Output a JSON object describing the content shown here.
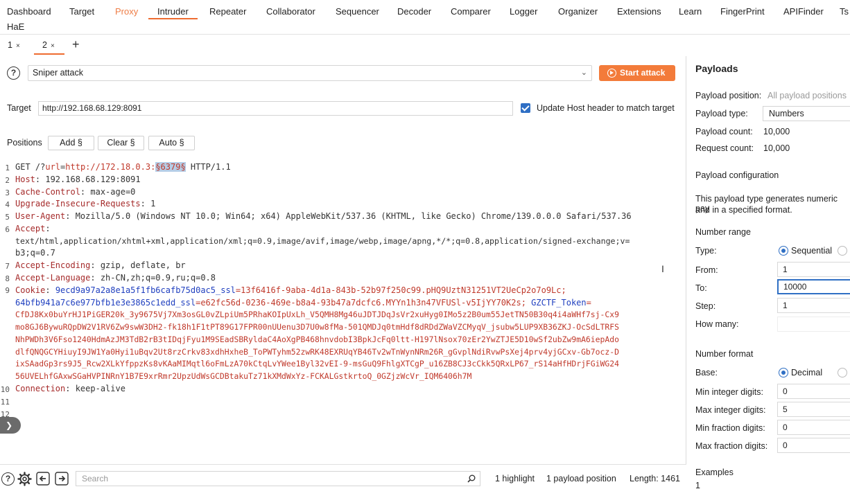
{
  "nav": {
    "tabs": [
      "Dashboard",
      "Target",
      "Proxy",
      "Intruder",
      "Repeater",
      "Collaborator",
      "Sequencer",
      "Decoder",
      "Comparer",
      "Logger",
      "Organizer",
      "Extensions",
      "Learn",
      "FingerPrint",
      "APIFinder",
      "Ts"
    ],
    "second_row": "HaE"
  },
  "subtabs": [
    {
      "label": "1",
      "close": "×"
    },
    {
      "label": "2",
      "close": "×"
    }
  ],
  "add_tab": "+",
  "attack": {
    "help": "?",
    "type_value": "Sniper attack",
    "start_label": "Start attack"
  },
  "target": {
    "label": "Target",
    "value": "http://192.168.68.129:8091",
    "update_host_label": "Update Host header to match target"
  },
  "positions": {
    "label": "Positions",
    "add": "Add §",
    "clear": "Clear §",
    "auto": "Auto §"
  },
  "request": {
    "line1": {
      "method": "GET /?",
      "param": "url",
      "eq": "=",
      "prefix": "http://172.18.0.3:",
      "marker": "§6379§",
      "version": " HTTP/1.1"
    },
    "host": {
      "k": "Host",
      "v": ": 192.168.68.129:8091"
    },
    "cache": {
      "k": "Cache-Control",
      "v": ": max-age=0"
    },
    "upgrade": {
      "k": "Upgrade-Insecure-Requests",
      "v": ": 1"
    },
    "ua": {
      "k": "User-Agent",
      "v": ": Mozilla/5.0 (Windows NT 10.0; Win64; x64) AppleWebKit/537.36 (KHTML, like Gecko) Chrome/139.0.0.0 Safari/537.36"
    },
    "accept": {
      "k": "Accept",
      "v": ":"
    },
    "accept_val1": "text/html,application/xhtml+xml,application/xml;q=0.9,image/avif,image/webp,image/apng,*/*;q=0.8,application/signed-exchange;v=",
    "accept_val2": "b3;q=0.7",
    "encoding": {
      "k": "Accept-Encoding",
      "v": ": gzip, deflate, br"
    },
    "language": {
      "k": "Accept-Language",
      "v": ": zh-CN,zh;q=0.9,ru;q=0.8"
    },
    "cookie_k": "Cookie",
    "cookie1_name": "9ecd9a97a2a8e1a5f1fb6cafb75d0ac5_ssl",
    "cookie1_val": "=13f6416f-9aba-4d1a-843b-52b97f250c99.pHQ9UztN31251VT2UeCp2o7o9Lc;",
    "cookie2_name": "64bfb941a7c6e977bfb1e3e3865c1edd_ssl",
    "cookie2_val": "=e62fc56d-0236-469e-b8a4-93b47a7dcfc6.MYYn1h3n47VFUSl-v5IjYY70K2s;",
    "cookie3_name": "GZCTF_Token",
    "cookie3_eq": "=",
    "cookie_lines": [
      "CfDJ8Kx0buYrHJ1PiGER20k_3y9675Vj7Xm3osGL0vZLpiUm5PRhaKOIpUxLh_V5QMH8Mg46uJDTJDqJsVr2xuHyg0IMo5z2B0um55JetTN50B30q4i4aWHf7sj-Cx9",
      "mo8GJ6BywuRQpDW2V1RV6Zw9swW3DH2-fk18h1F1tPT89G17FPR00nUUenu3D7U0w8fMa-501QMDJq0tmHdf8dRDdZWaVZCMyqV_jsubw5LUP9XB36ZKJ-OcSdLTRFS",
      "NhPWDh3V6Fso1240HdmAzJM3TdB2rB3tIDqjFyu1M9SEadSBRyldaC4AoXgPB468hnvdobI3BpkJcFq0ltt-H197lNsox70zEr2YwZTJE5D10wSf2ubZw9mA6iepAdo",
      "dlfQNQGCYHiuyI9JW1Ya0Hyi1uBqv2Ut8rzCrkv83xdhHxheB_ToPWTyhm52zwRK48EXRUqYB46Tv2wTnWynNRm26R_gGvplNdiRvwPsXej4prv4yjGCxv-Gb7ocz-D",
      "ixSAadGp3rs9J5_Rcw2XLkYfppzKs8vKAaMIMqtl6oFmLzA70kCtqLvYWee1Byl32vEI-9-msGuQ9FhlgXTCgP_u16ZB8CJ3cCkk5QRxLP67_rS14aHfHDrjFGiWG24",
      "56UVELhfGAxwSGaHVPINRnY1B7E9xrRmr2UpzUdWsGCDBtakuTz71kXMdWxYz-FCKALGstkrtoQ_0GZjzWcVr_IQM6406h7M"
    ],
    "connection": {
      "k": "Connection",
      "v": ": keep-alive"
    },
    "line_numbers": [
      "1",
      "2",
      "3",
      "4",
      "5",
      "6",
      "7",
      "8",
      "9",
      "10",
      "11",
      "12"
    ]
  },
  "bottom": {
    "search_placeholder": "Search",
    "highlights": "1 highlight",
    "payload_positions": "1 payload position",
    "length": "Length: 1461"
  },
  "payloads": {
    "title": "Payloads",
    "position_label": "Payload position:",
    "position_value": "All payload positions",
    "type_label": "Payload type:",
    "type_value": "Numbers",
    "count_label": "Payload count:",
    "count_value": "10,000",
    "request_label": "Request count:",
    "request_value": "10,000",
    "config_title": "Payload configuration",
    "config_desc1": "This payload type generates numeric pay",
    "config_desc2": "and in a specified format.",
    "range_title": "Number range",
    "type2_label": "Type:",
    "sequential": "Sequential",
    "from_label": "From:",
    "from_value": "1",
    "to_label": "To:",
    "to_value": "10000",
    "step_label": "Step:",
    "step_value": "1",
    "howmany_label": "How many:",
    "format_title": "Number format",
    "base_label": "Base:",
    "decimal": "Decimal",
    "min_int_label": "Min integer digits:",
    "min_int_value": "0",
    "max_int_label": "Max integer digits:",
    "max_int_value": "5",
    "min_frac_label": "Min fraction digits:",
    "min_frac_value": "0",
    "max_frac_label": "Max fraction digits:",
    "max_frac_value": "0",
    "examples_title": "Examples",
    "example1": "1"
  }
}
